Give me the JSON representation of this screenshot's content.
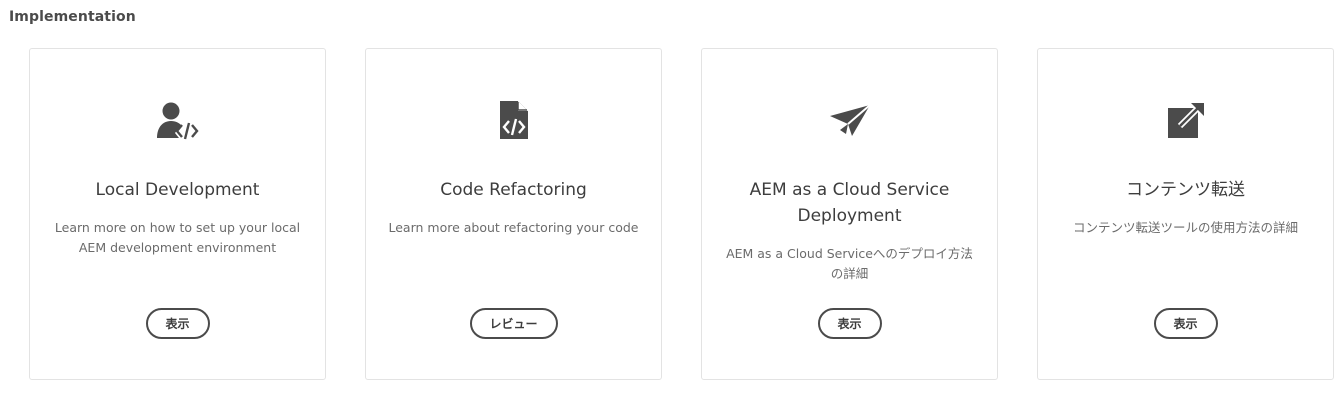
{
  "section": {
    "title": "Implementation"
  },
  "cards": [
    {
      "icon": "user-code-icon",
      "title": "Local Development",
      "description": "Learn more on how to set up your local AEM development environment",
      "button_label": "表示"
    },
    {
      "icon": "code-file-icon",
      "title": "Code Refactoring",
      "description": "Learn more about refactoring your code",
      "button_label": "レビュー"
    },
    {
      "icon": "paper-plane-icon",
      "title": "AEM as a Cloud Service Deployment",
      "description": "AEM as a Cloud Serviceへのデプロイ方法の詳細",
      "button_label": "表示"
    },
    {
      "icon": "launch-out-icon",
      "title": "コンテンツ転送",
      "description": "コンテンツ転送ツールの使用方法の詳細",
      "button_label": "表示"
    }
  ],
  "colors": {
    "icon": "#4b4b4b",
    "border": "#e3e3e3",
    "text": "#3d3d3d"
  }
}
